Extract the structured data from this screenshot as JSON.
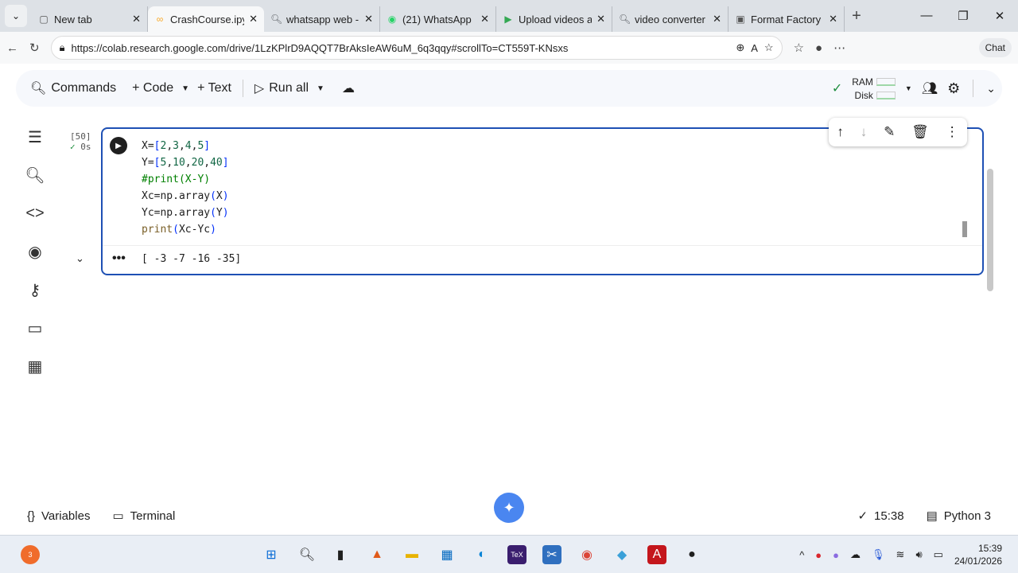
{
  "browser": {
    "tabs": [
      {
        "label": "New tab",
        "icon": "page-icon"
      },
      {
        "label": "CrashCourse.ipynb",
        "icon": "colab-icon",
        "active": true
      },
      {
        "label": "whatsapp web -",
        "icon": "search-icon"
      },
      {
        "label": "(21) WhatsApp",
        "icon": "whatsapp-icon"
      },
      {
        "label": "Upload videos at",
        "icon": "play-icon"
      },
      {
        "label": "video converter f",
        "icon": "search-icon"
      },
      {
        "label": "Format Factory -",
        "icon": "app-icon"
      }
    ],
    "url": "https://colab.research.google.com/drive/1LzKPlrD9AQQT7BrAksIeAW6uM_6q3qqy#scrollTo=CT559T-KNsxs",
    "chat_label": "Chat"
  },
  "toolbar": {
    "commands": "Commands",
    "code": "+ Code",
    "text": "+ Text",
    "run_all": "Run all",
    "ram": "RAM",
    "disk": "Disk"
  },
  "cell": {
    "exec_count": "[50]",
    "exec_time": "0s",
    "lines": [
      [
        {
          "t": "X=",
          "k": ""
        },
        {
          "t": "[",
          "k": "br"
        },
        {
          "t": "2",
          "k": "num"
        },
        {
          "t": ",",
          "k": ""
        },
        {
          "t": "3",
          "k": "num"
        },
        {
          "t": ",",
          "k": ""
        },
        {
          "t": "4",
          "k": "num"
        },
        {
          "t": ",",
          "k": ""
        },
        {
          "t": "5",
          "k": "num"
        },
        {
          "t": "]",
          "k": "br"
        }
      ],
      [
        {
          "t": "Y=",
          "k": ""
        },
        {
          "t": "[",
          "k": "br"
        },
        {
          "t": "5",
          "k": "num"
        },
        {
          "t": ",",
          "k": ""
        },
        {
          "t": "10",
          "k": "num"
        },
        {
          "t": ",",
          "k": ""
        },
        {
          "t": "20",
          "k": "num"
        },
        {
          "t": ",",
          "k": ""
        },
        {
          "t": "40",
          "k": "num"
        },
        {
          "t": "]",
          "k": "br"
        }
      ],
      [
        {
          "t": "#print(X-Y)",
          "k": "cm"
        }
      ],
      [
        {
          "t": "Xc=np.array",
          "k": ""
        },
        {
          "t": "(",
          "k": "pn"
        },
        {
          "t": "X",
          "k": ""
        },
        {
          "t": ")",
          "k": "pn"
        }
      ],
      [
        {
          "t": "Yc=np.array",
          "k": ""
        },
        {
          "t": "(",
          "k": "pn"
        },
        {
          "t": "Y",
          "k": ""
        },
        {
          "t": ")",
          "k": "pn"
        }
      ],
      [
        {
          "t": "print",
          "k": "fn"
        },
        {
          "t": "(",
          "k": "pn"
        },
        {
          "t": "Xc-Yc",
          "k": ""
        },
        {
          "t": ")",
          "k": "pn"
        }
      ]
    ],
    "output": "[ -3  -7 -16 -35]"
  },
  "bottom": {
    "variables": "Variables",
    "terminal": "Terminal",
    "time": "15:38",
    "runtime": "Python 3"
  },
  "taskbar": {
    "badge": "3",
    "time": "15:39",
    "date": "24/01/2026"
  }
}
